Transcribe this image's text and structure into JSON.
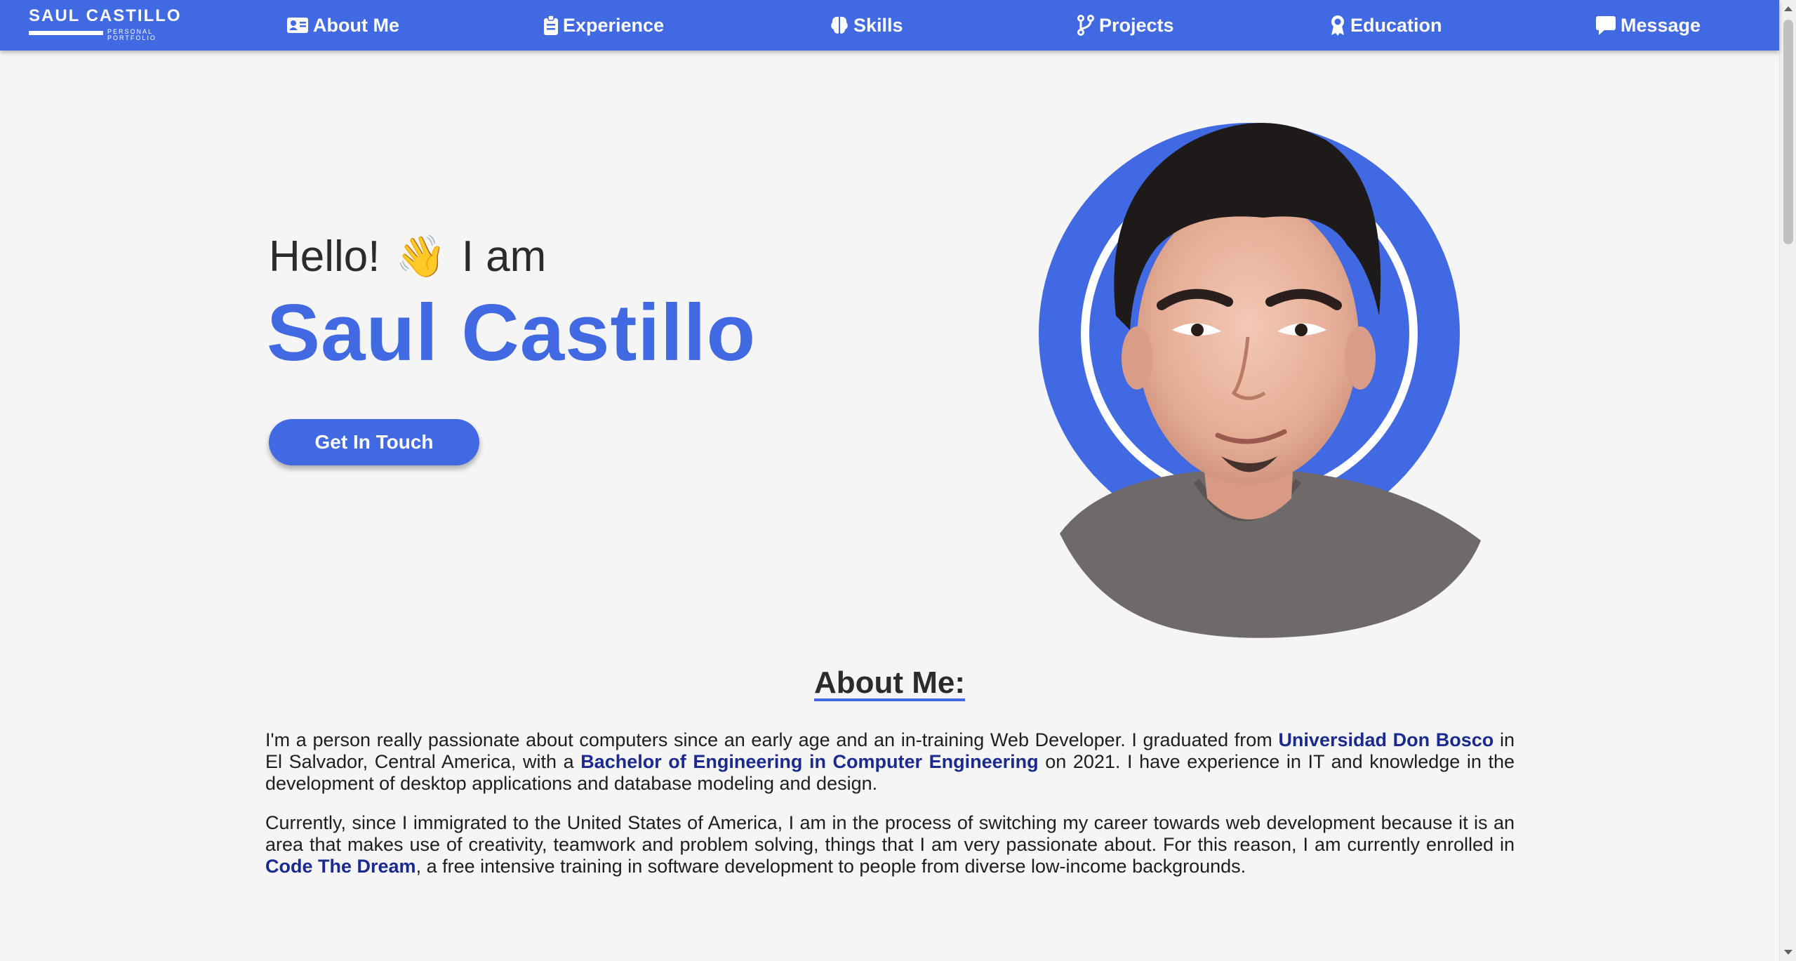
{
  "brand": {
    "name": "SAUL CASTILLO",
    "subtitle": "PERSONAL PORTFOLIO"
  },
  "nav": {
    "items": [
      {
        "label": "About Me",
        "icon": "id-card-icon"
      },
      {
        "label": "Experience",
        "icon": "clipboard-icon"
      },
      {
        "label": "Skills",
        "icon": "brain-icon"
      },
      {
        "label": "Projects",
        "icon": "code-branch-icon"
      },
      {
        "label": "Education",
        "icon": "award-icon"
      },
      {
        "label": "Message",
        "icon": "message-icon"
      }
    ]
  },
  "hero": {
    "greeting_before": "Hello!",
    "greeting_emoji": "👋",
    "greeting_after": "I am",
    "name": "Saul Castillo",
    "cta_label": "Get In Touch"
  },
  "about": {
    "title": "About Me:",
    "p1": {
      "t1": "I'm a person really passionate about computers since an early age and an in-training Web Developer. I graduated from ",
      "b1": "Universidad Don Bosco",
      "t2": " in El Salvador, Central America, with a ",
      "b2": "Bachelor of Engineering in Computer Engineering",
      "t3": " on 2021. I have experience in IT and knowledge in the development of desktop applications and database modeling and design."
    },
    "p2": {
      "t1": "Currently, since I immigrated to the United States of America, I am in the process of switching my career towards web development because it is an area that makes use of creativity, teamwork and problem solving, things that I am very passionate about. For this reason, I am currently enrolled in ",
      "b1": "Code The Dream",
      "t2": ", a free intensive training in software development to people from diverse low-income backgrounds."
    }
  },
  "colors": {
    "accent": "#4169e1",
    "background": "#f5f5f5",
    "highlight_text": "#1a2a8f"
  }
}
